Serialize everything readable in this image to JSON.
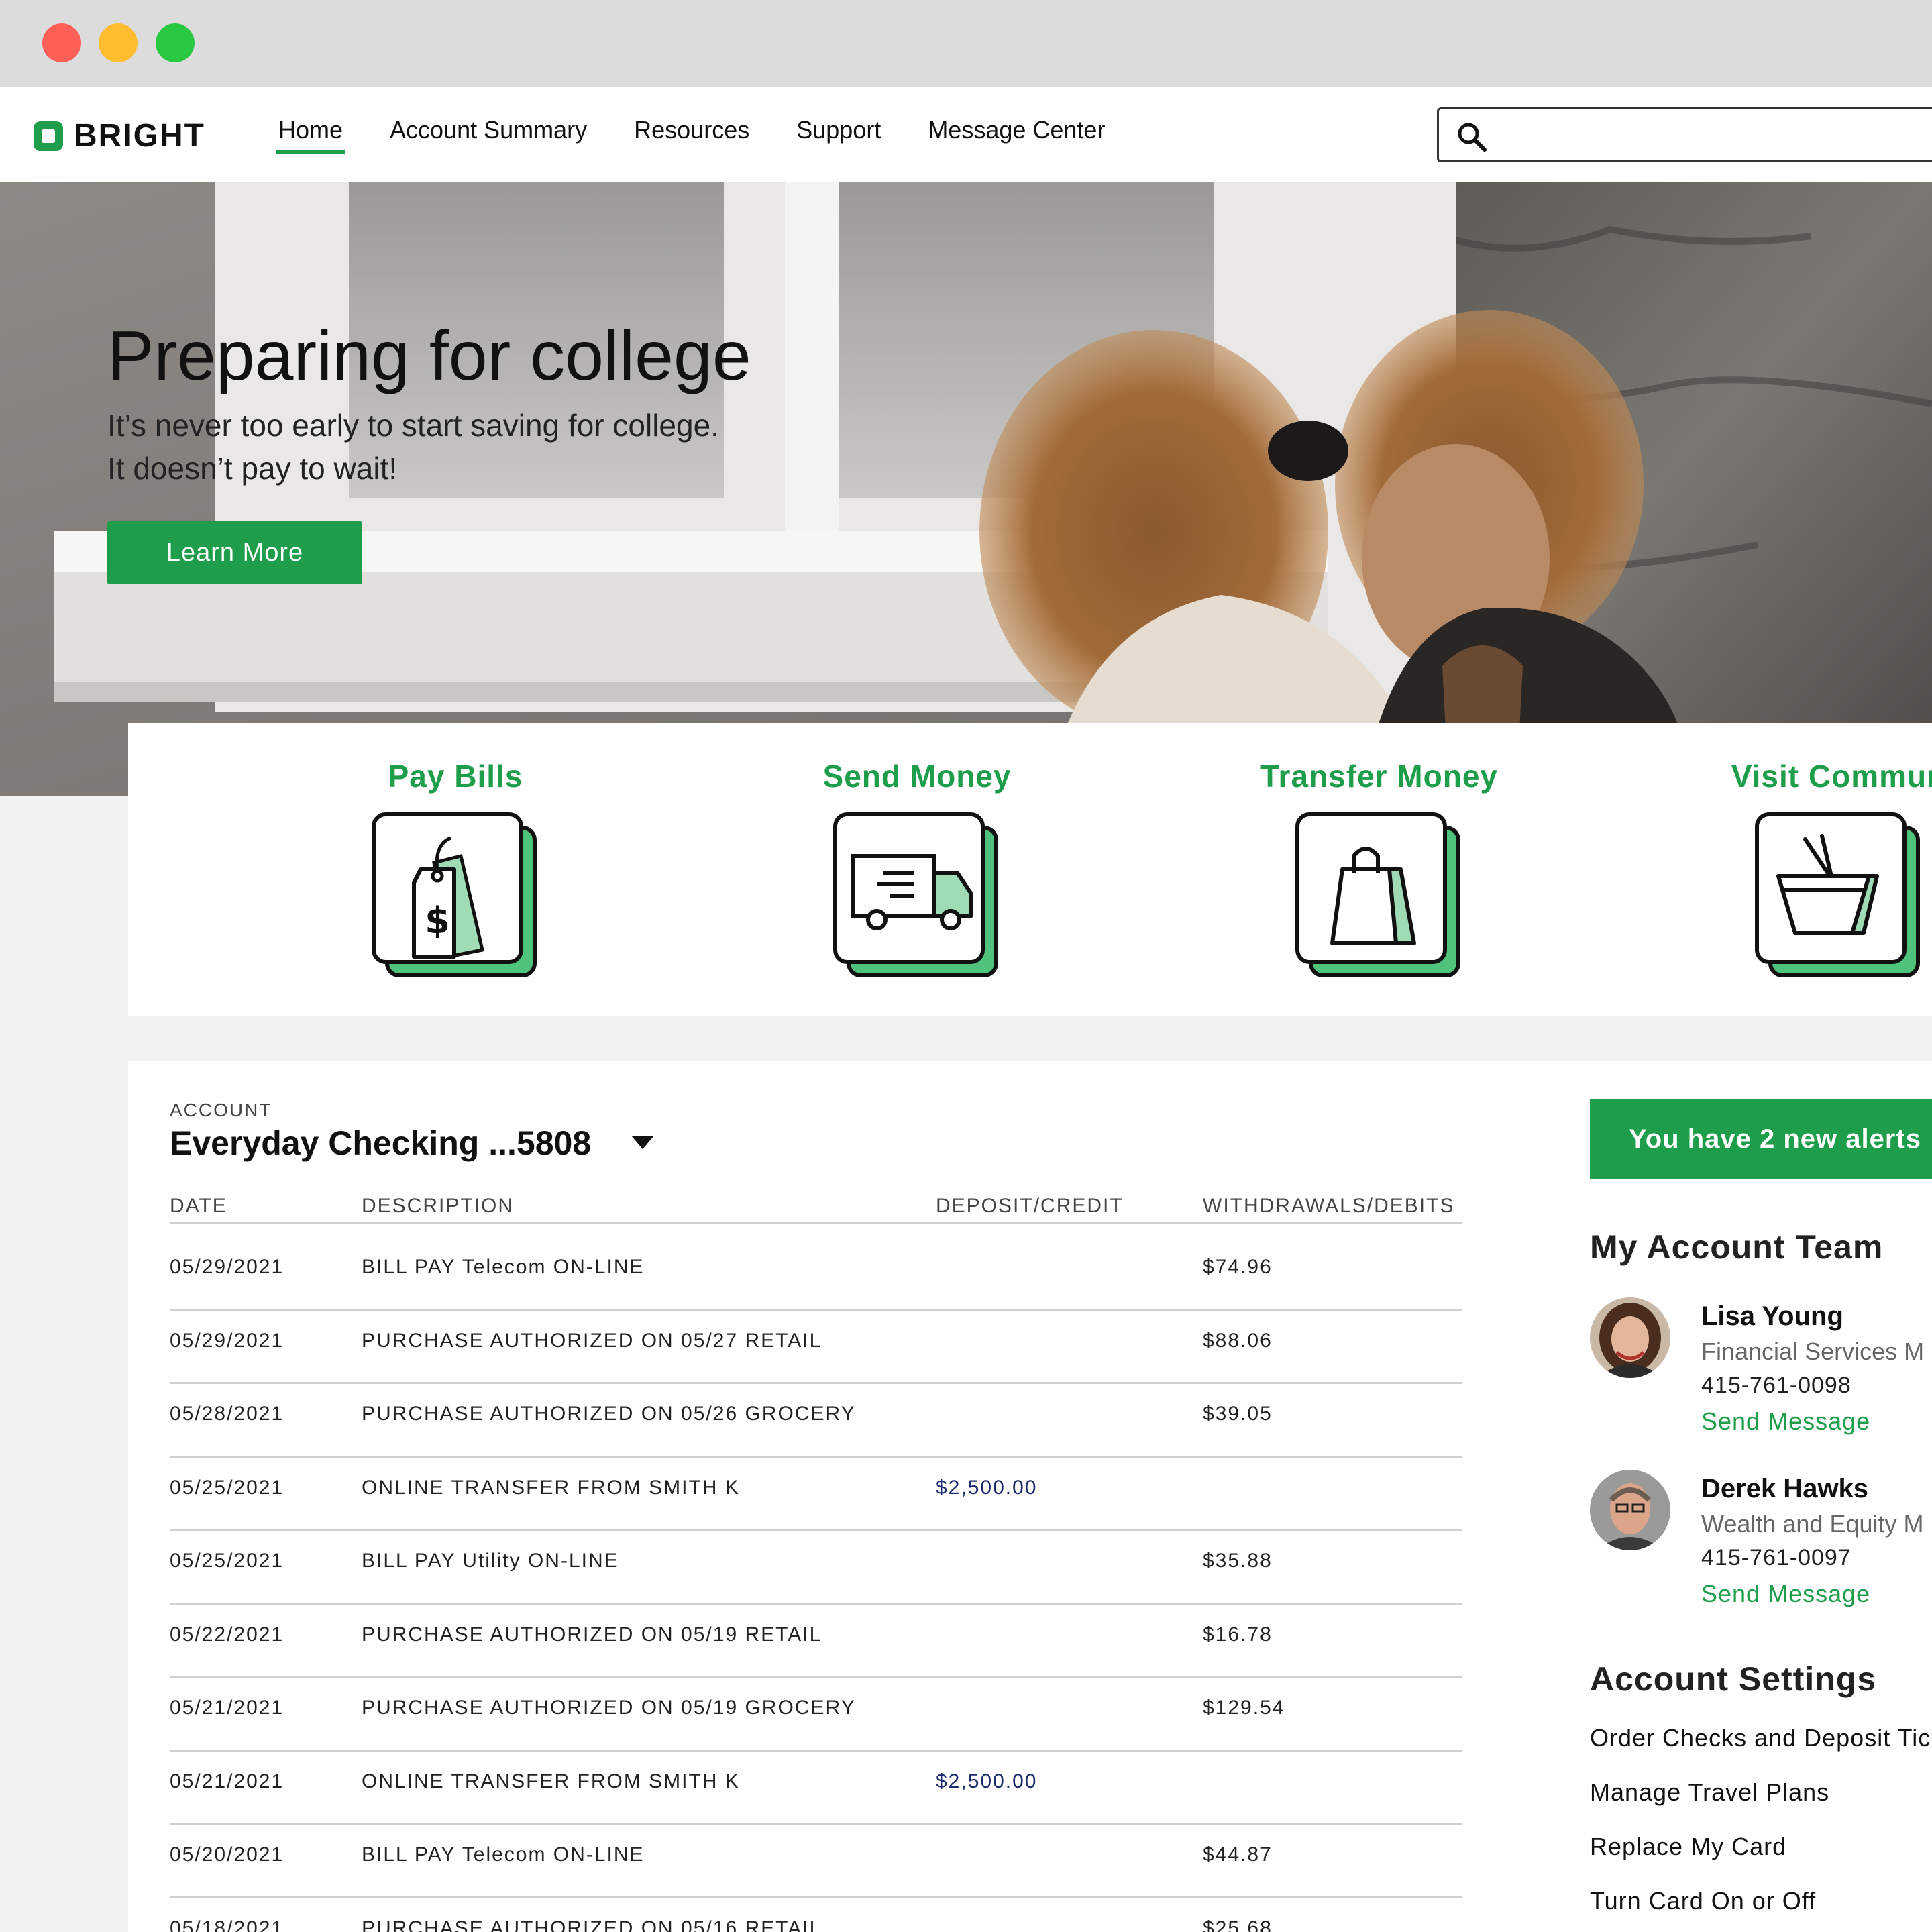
{
  "brand": {
    "name": "BRIGHT",
    "accent": "#1e9e4a"
  },
  "nav": {
    "items": [
      {
        "label": "Home",
        "active": true
      },
      {
        "label": "Account Summary",
        "active": false
      },
      {
        "label": "Resources",
        "active": false
      },
      {
        "label": "Support",
        "active": false
      },
      {
        "label": "Message Center",
        "active": false
      }
    ]
  },
  "search": {
    "placeholder": "",
    "icon": "search-icon"
  },
  "hero": {
    "title": "Preparing for college",
    "line1": "It’s never too early to start saving for college.",
    "line2": "It doesn’t pay to wait!",
    "button": "Learn More"
  },
  "actions": [
    {
      "label": "Pay Bills",
      "icon": "price-tag-icon"
    },
    {
      "label": "Send Money",
      "icon": "delivery-truck-icon"
    },
    {
      "label": "Transfer Money",
      "icon": "shopping-bag-icon"
    },
    {
      "label": "Visit Commun",
      "icon": "shopping-basket-icon"
    }
  ],
  "account": {
    "label": "ACCOUNT",
    "name": "Everyday Checking ...5808",
    "columns": {
      "date": "DATE",
      "description": "DESCRIPTION",
      "credit": "DEPOSIT/CREDIT",
      "debit": "WITHDRAWALS/DEBITS"
    },
    "transactions": [
      {
        "date": "05/29/2021",
        "description": "BILL PAY Telecom ON-LINE",
        "credit": "",
        "debit": "$74.96"
      },
      {
        "date": "05/29/2021",
        "description": "PURCHASE AUTHORIZED ON 05/27 RETAIL",
        "credit": "",
        "debit": "$88.06"
      },
      {
        "date": "05/28/2021",
        "description": "PURCHASE AUTHORIZED ON 05/26 GROCERY",
        "credit": "",
        "debit": "$39.05"
      },
      {
        "date": "05/25/2021",
        "description": "ONLINE TRANSFER FROM SMITH K",
        "credit": "$2,500.00",
        "debit": ""
      },
      {
        "date": "05/25/2021",
        "description": "BILL PAY Utility ON-LINE",
        "credit": "",
        "debit": "$35.88"
      },
      {
        "date": "05/22/2021",
        "description": "PURCHASE AUTHORIZED ON 05/19 RETAIL",
        "credit": "",
        "debit": "$16.78"
      },
      {
        "date": "05/21/2021",
        "description": "PURCHASE AUTHORIZED ON 05/19 GROCERY",
        "credit": "",
        "debit": "$129.54"
      },
      {
        "date": "05/21/2021",
        "description": "ONLINE TRANSFER FROM SMITH K",
        "credit": "$2,500.00",
        "debit": ""
      },
      {
        "date": "05/20/2021",
        "description": "BILL PAY Telecom ON-LINE",
        "credit": "",
        "debit": "$44.87"
      },
      {
        "date": "05/18/2021",
        "description": "PURCHASE AUTHORIZED ON 05/16 RETAIL",
        "credit": "",
        "debit": "$25.68"
      }
    ]
  },
  "sidebar": {
    "alerts": "You have 2 new alerts",
    "team_title": "My Account Team",
    "team": [
      {
        "name": "Lisa Young",
        "role": "Financial Services M",
        "phone": "415-761-0098",
        "action": "Send Message"
      },
      {
        "name": "Derek Hawks",
        "role": "Wealth and Equity M",
        "phone": "415-761-0097",
        "action": "Send Message"
      }
    ],
    "settings_title": "Account Settings",
    "settings": [
      "Order Checks and Deposit Tic",
      "Manage Travel Plans",
      "Replace My Card",
      "Turn Card On or Off"
    ]
  }
}
